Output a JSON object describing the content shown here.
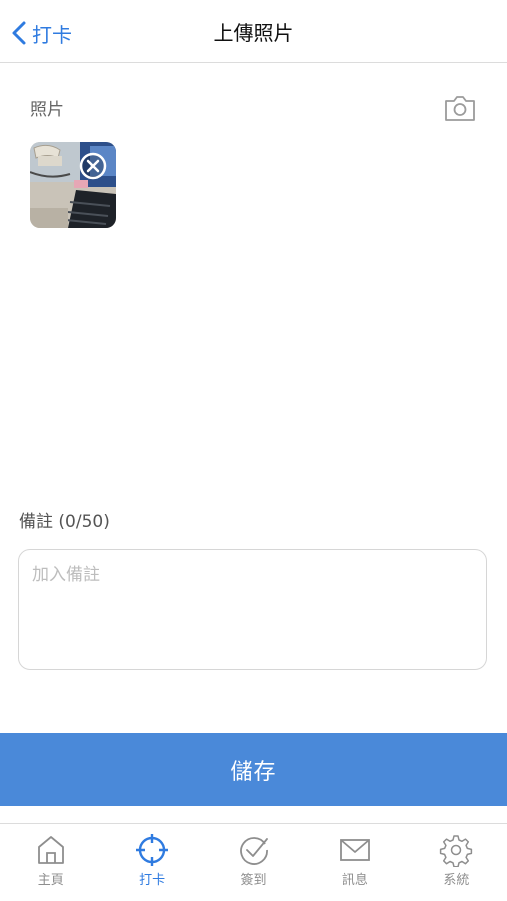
{
  "nav": {
    "back_label": "打卡",
    "title": "上傳照片"
  },
  "photos": {
    "label": "照片",
    "camera_icon": "camera-icon",
    "remove_icon": "remove-circle-icon"
  },
  "note": {
    "label": "備註 (0/50)",
    "placeholder": "加入備註"
  },
  "save_label": "儲存",
  "tabs": [
    {
      "label": "主頁",
      "icon": "home-icon",
      "active": false
    },
    {
      "label": "打卡",
      "icon": "crosshair-icon",
      "active": true
    },
    {
      "label": "簽到",
      "icon": "check-circle-icon",
      "active": false
    },
    {
      "label": "訊息",
      "icon": "mail-icon",
      "active": false
    },
    {
      "label": "系統",
      "icon": "gear-icon",
      "active": false
    }
  ],
  "colors": {
    "accent": "#2f7be0",
    "button": "#4a89d9",
    "inactive": "#8e8e8e"
  }
}
